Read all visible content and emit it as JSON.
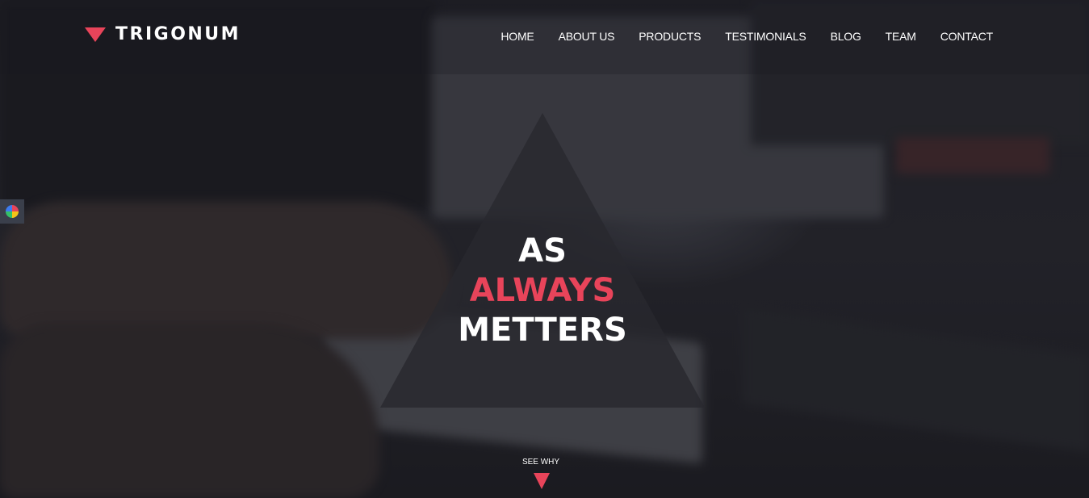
{
  "brand": {
    "name": "TRIGONUM",
    "accent": "#e8445a"
  },
  "nav": {
    "items": [
      "HOME",
      "ABOUT US",
      "PRODUCTS",
      "TESTIMONIALS",
      "BLOG",
      "TEAM",
      "CONTACT"
    ]
  },
  "hero": {
    "line1": "AS",
    "line2": "ALWAYS",
    "line3": "METTERS",
    "cta_label": "SEE WHY"
  },
  "icons": {
    "brand": "triangle-logo-icon",
    "widget": "pinwheel-icon",
    "cta": "down-triangle-icon"
  }
}
